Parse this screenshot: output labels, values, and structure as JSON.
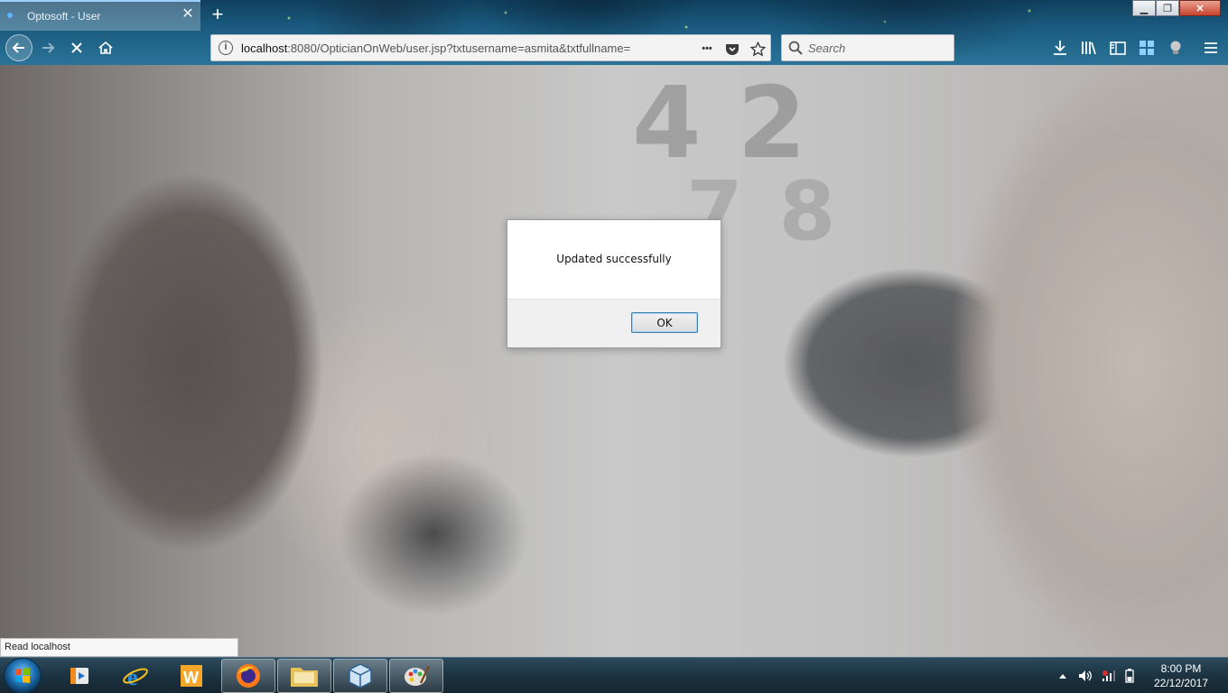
{
  "browser": {
    "tab_title": "Optosoft - User",
    "tab_close_glyph": "✕",
    "new_tab_glyph": "+",
    "url_host": "localhost",
    "url_rest": ":8080/OpticianOnWeb/user.jsp?txtusername=asmita&txtfullname=",
    "search_placeholder": "Search",
    "page_actions_glyph": "•••",
    "window_min_glyph": "▁",
    "window_restore_glyph": "❐",
    "window_close_glyph": "✕"
  },
  "page": {
    "background_image": "eye-examination-photo",
    "chart_row1": "42",
    "chart_row2": "78"
  },
  "dialog": {
    "message": "Updated successfully",
    "ok_label": "OK"
  },
  "status_bar": {
    "text": "Read localhost"
  },
  "taskbar": {
    "apps": [
      {
        "name": "media-player",
        "active": false
      },
      {
        "name": "internet-explorer",
        "active": false
      },
      {
        "name": "word",
        "active": false
      },
      {
        "name": "firefox",
        "active": true
      },
      {
        "name": "file-explorer",
        "active": true
      },
      {
        "name": "virtualbox",
        "active": true
      },
      {
        "name": "paint",
        "active": true
      }
    ],
    "clock_time": "8:00 PM",
    "clock_date": "22/12/2017"
  },
  "colors": {
    "accent": "#3c7fb1",
    "chrome": "#1a5a7e"
  }
}
